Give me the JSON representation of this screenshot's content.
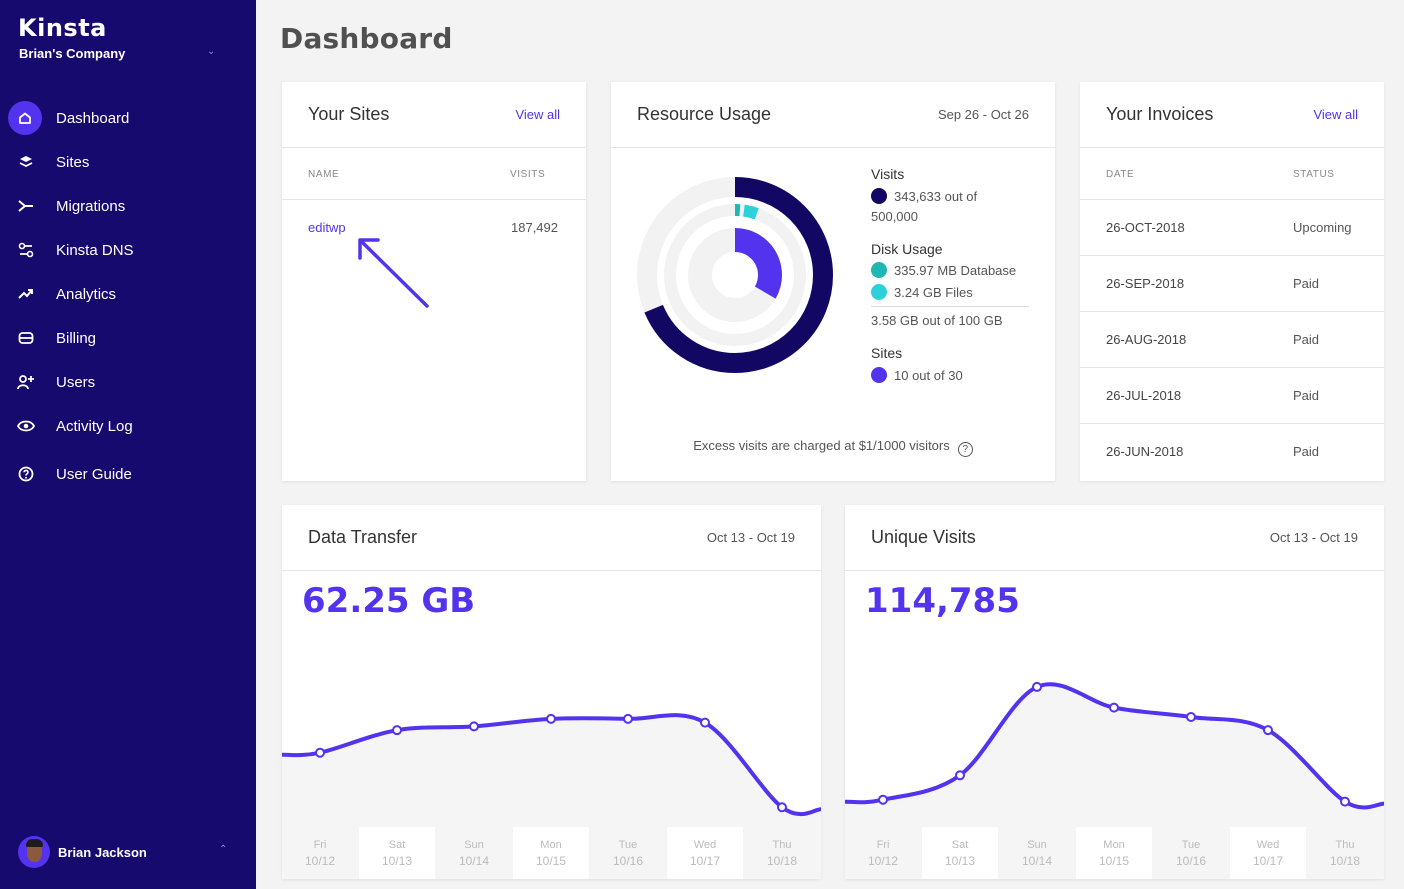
{
  "brand": {
    "logo": "Kinsta",
    "company": "Brian's Company"
  },
  "colors": {
    "sidebar": "#170a6e",
    "accent": "#5333ed",
    "navy": "#120763",
    "teal": "#1cb8b1",
    "cyan": "#2ed1d9"
  },
  "nav": [
    {
      "label": "Dashboard",
      "icon": "home-icon"
    },
    {
      "label": "Sites",
      "icon": "layers-icon"
    },
    {
      "label": "Migrations",
      "icon": "migrate-icon"
    },
    {
      "label": "Kinsta DNS",
      "icon": "dns-icon"
    },
    {
      "label": "Analytics",
      "icon": "analytics-icon"
    },
    {
      "label": "Billing",
      "icon": "billing-icon"
    },
    {
      "label": "Users",
      "icon": "add-user-icon"
    },
    {
      "label": "Activity Log",
      "icon": "eye-icon"
    },
    {
      "label": "User Guide",
      "icon": "help-icon"
    }
  ],
  "user": {
    "name": "Brian Jackson"
  },
  "page": {
    "title": "Dashboard"
  },
  "sites": {
    "title": "Your Sites",
    "view_all": "View all",
    "columns": [
      "NAME",
      "VISITS"
    ],
    "rows": [
      {
        "name": "editwp",
        "visits": "187,492"
      }
    ]
  },
  "resource": {
    "title": "Resource Usage",
    "range": "Sep 26 - Oct 26",
    "visits_label": "Visits",
    "visits_value": "343,633 out of",
    "visits_total": "500,000",
    "disk_label": "Disk Usage",
    "db_value": "335.97 MB Database",
    "files_value": "3.24 GB Files",
    "disk_total": "3.58 GB out of 100 GB",
    "sites_label": "Sites",
    "sites_value": "10 out of 30",
    "excess": "Excess visits are charged at $1/1000 visitors",
    "usage": {
      "visits": 343633,
      "visits_max": 500000,
      "disk_db_gb": 0.33597,
      "disk_files_gb": 3.24,
      "disk_max_gb": 100,
      "sites": 10,
      "sites_max": 30
    }
  },
  "invoices": {
    "title": "Your Invoices",
    "view_all": "View all",
    "columns": [
      "DATE",
      "STATUS"
    ],
    "rows": [
      {
        "date": "26-OCT-2018",
        "status": "Upcoming"
      },
      {
        "date": "26-SEP-2018",
        "status": "Paid"
      },
      {
        "date": "26-AUG-2018",
        "status": "Paid"
      },
      {
        "date": "26-JUL-2018",
        "status": "Paid"
      },
      {
        "date": "26-JUN-2018",
        "status": "Paid"
      }
    ]
  },
  "transfer": {
    "title": "Data Transfer",
    "range": "Oct 13 - Oct 19",
    "total": "62.25 GB"
  },
  "unique": {
    "title": "Unique Visits",
    "range": "Oct 13 - Oct 19",
    "total": "114,785"
  },
  "chart_data": [
    {
      "type": "line",
      "categories": [
        [
          "Fri",
          "10/12"
        ],
        [
          "Sat",
          "10/13"
        ],
        [
          "Sun",
          "10/14"
        ],
        [
          "Mon",
          "10/15"
        ],
        [
          "Tue",
          "10/16"
        ],
        [
          "Wed",
          "10/17"
        ],
        [
          "Thu",
          "10/18"
        ]
      ],
      "values": [
        0.31,
        0.43,
        0.45,
        0.49,
        0.49,
        0.47,
        0.02
      ],
      "ylim": [
        0,
        1
      ],
      "grid": false,
      "title": "",
      "xlabel": "",
      "ylabel": ""
    },
    {
      "type": "line",
      "categories": [
        [
          "Fri",
          "10/12"
        ],
        [
          "Sat",
          "10/13"
        ],
        [
          "Sun",
          "10/14"
        ],
        [
          "Mon",
          "10/15"
        ],
        [
          "Tue",
          "10/16"
        ],
        [
          "Wed",
          "10/17"
        ],
        [
          "Thu",
          "10/18"
        ]
      ],
      "values": [
        0.06,
        0.19,
        0.66,
        0.55,
        0.5,
        0.43,
        0.05
      ],
      "ylim": [
        0,
        1
      ],
      "grid": false,
      "title": "",
      "xlabel": "",
      "ylabel": ""
    }
  ]
}
